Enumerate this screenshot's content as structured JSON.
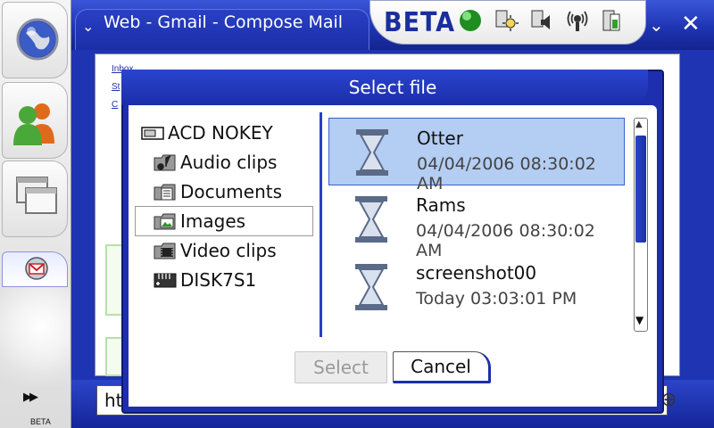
{
  "window": {
    "title": "Web - Gmail - Compose Mail",
    "beta_label": "BETA"
  },
  "left_nav": {
    "bottom_label": "BETA",
    "bottom_arrows": "▶▶"
  },
  "status_icons": [
    "green-status-icon",
    "brightness-icon",
    "volume-icon",
    "connectivity-icon",
    "battery-icon"
  ],
  "window_controls": {
    "minimize": "⌄",
    "close": "✕"
  },
  "dialog": {
    "title": "Select file",
    "folders": [
      {
        "label": "ACD NOKEY",
        "icon": "device-icon"
      },
      {
        "label": "Audio clips",
        "icon": "audio-folder-icon"
      },
      {
        "label": "Documents",
        "icon": "documents-folder-icon"
      },
      {
        "label": "Images",
        "icon": "images-folder-icon",
        "selected": true
      },
      {
        "label": "Video clips",
        "icon": "video-folder-icon"
      },
      {
        "label": "DISK7S1",
        "icon": "memory-card-icon"
      }
    ],
    "files": [
      {
        "name": "Otter",
        "date": "04/04/2006 08:30:02 AM",
        "selected": true
      },
      {
        "name": "Rams",
        "date": "04/04/2006 08:30:02 AM"
      },
      {
        "name": "screenshot00",
        "date": "Today 03:03:01 PM"
      }
    ],
    "buttons": {
      "select": "Select",
      "cancel": "Cancel"
    }
  },
  "address_bar": {
    "value": "ht"
  },
  "colors": {
    "chrome_blue": "#1f34b3",
    "selection_blue": "#b4cdf2",
    "disabled_text": "#9a9a9a"
  }
}
